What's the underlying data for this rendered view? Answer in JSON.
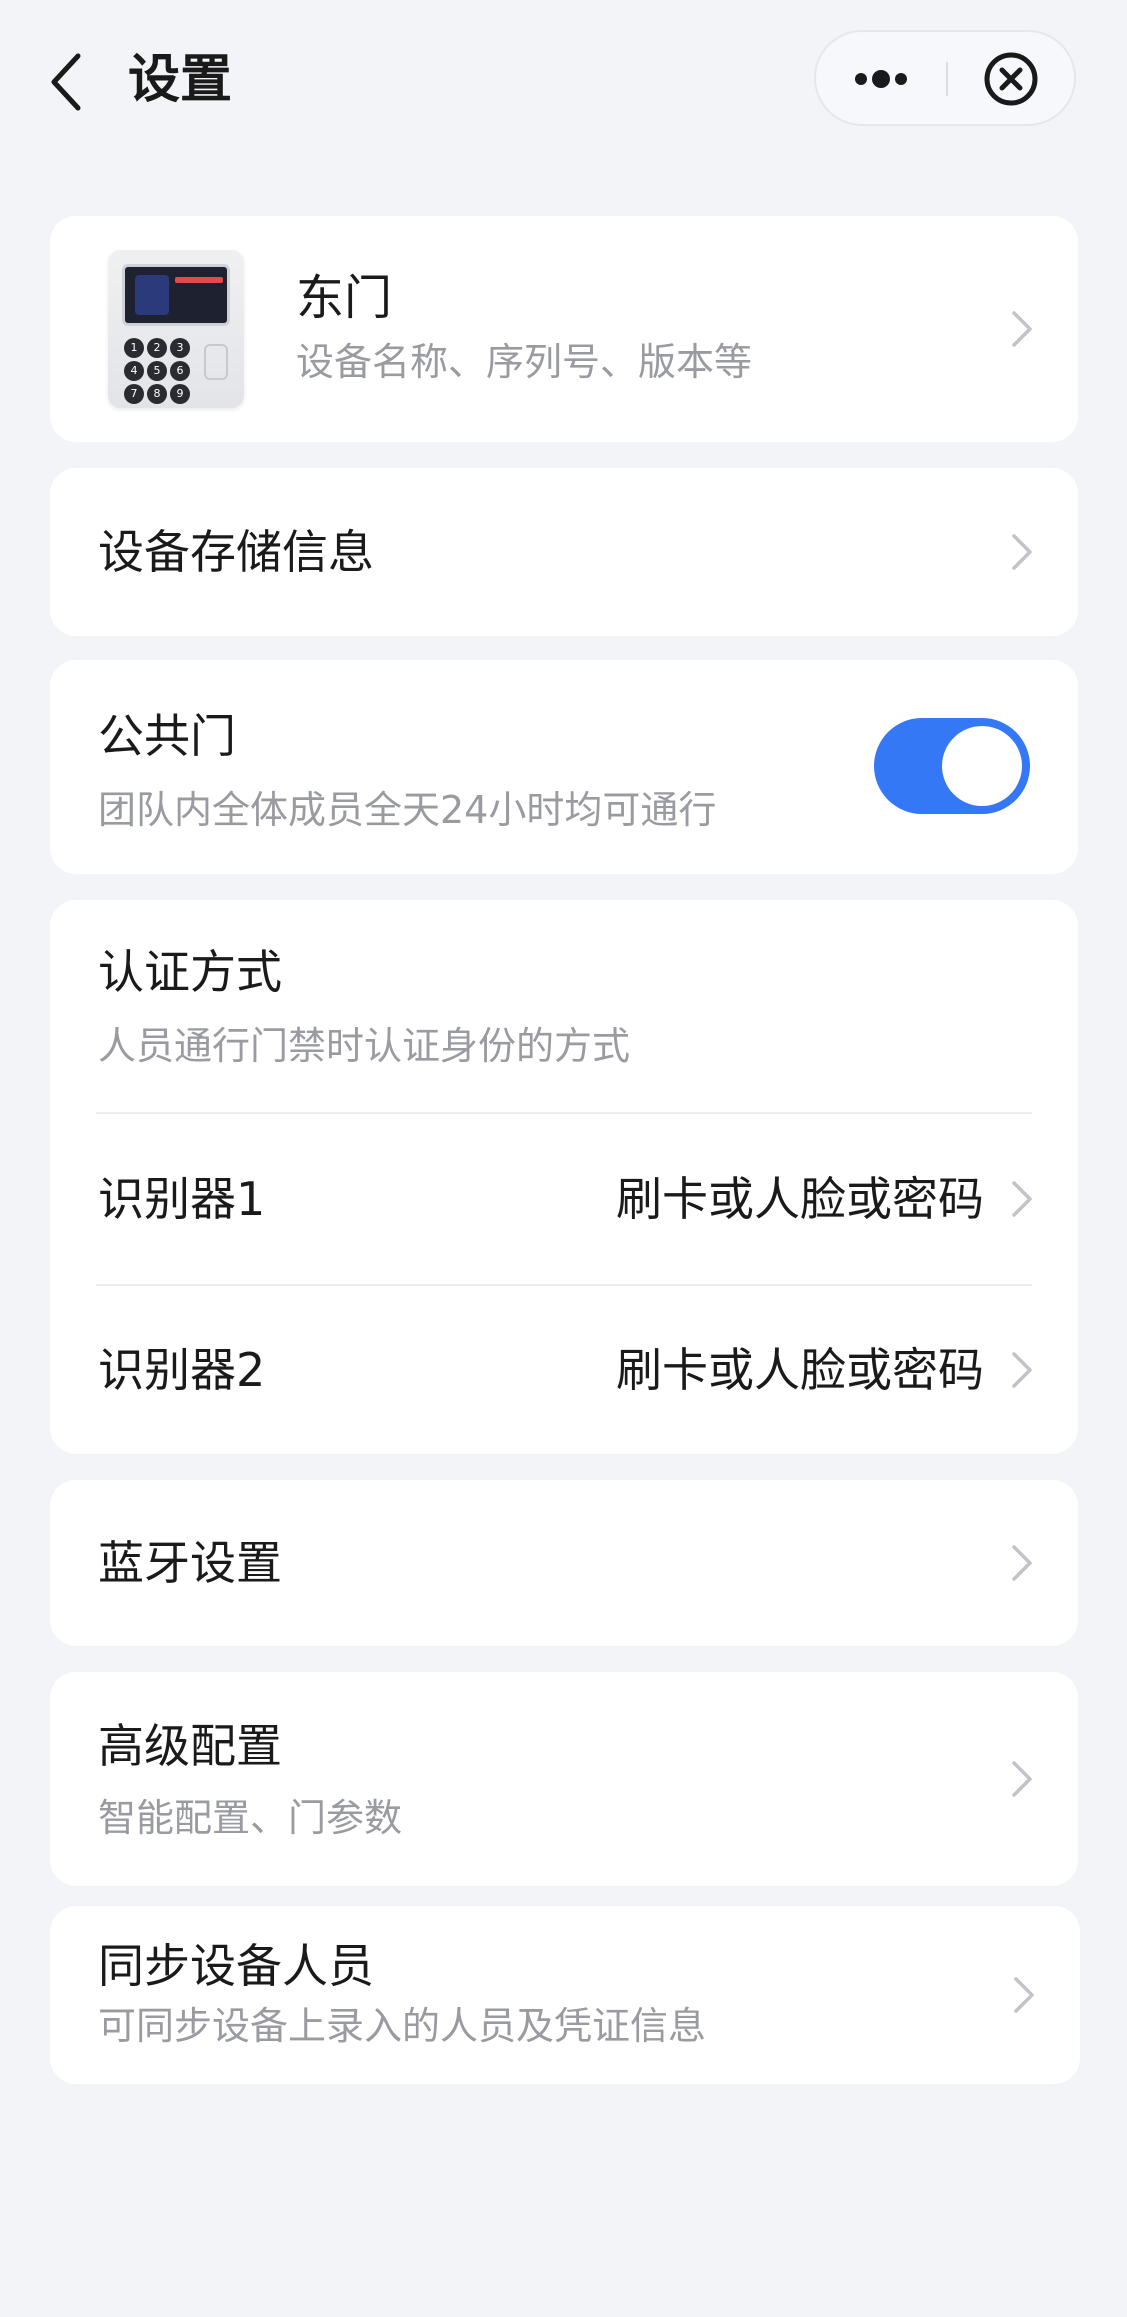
{
  "header": {
    "title": "设置"
  },
  "device_card": {
    "name": "东门",
    "subtitle": "设备名称、序列号、版本等",
    "keys": [
      "1",
      "2",
      "3",
      "4",
      "5",
      "6",
      "7",
      "8",
      "9"
    ]
  },
  "storage": {
    "label": "设备存储信息"
  },
  "public_door": {
    "label": "公共门",
    "subtitle": "团队内全体成员全天24小时均可通行",
    "enabled": true
  },
  "auth": {
    "label": "认证方式",
    "subtitle": "人员通行门禁时认证身份的方式",
    "readers": [
      {
        "label": "识别器1",
        "value": "刷卡或人脸或密码"
      },
      {
        "label": "识别器2",
        "value": "刷卡或人脸或密码"
      }
    ]
  },
  "bluetooth": {
    "label": "蓝牙设置"
  },
  "advanced": {
    "label": "高级配置",
    "subtitle": "智能配置、门参数"
  },
  "sync": {
    "label": "同步设备人员",
    "subtitle": "可同步设备上录入的人员及凭证信息"
  },
  "colors": {
    "accent": "#3478f6",
    "background": "#f3f4f8",
    "card": "#ffffff"
  }
}
